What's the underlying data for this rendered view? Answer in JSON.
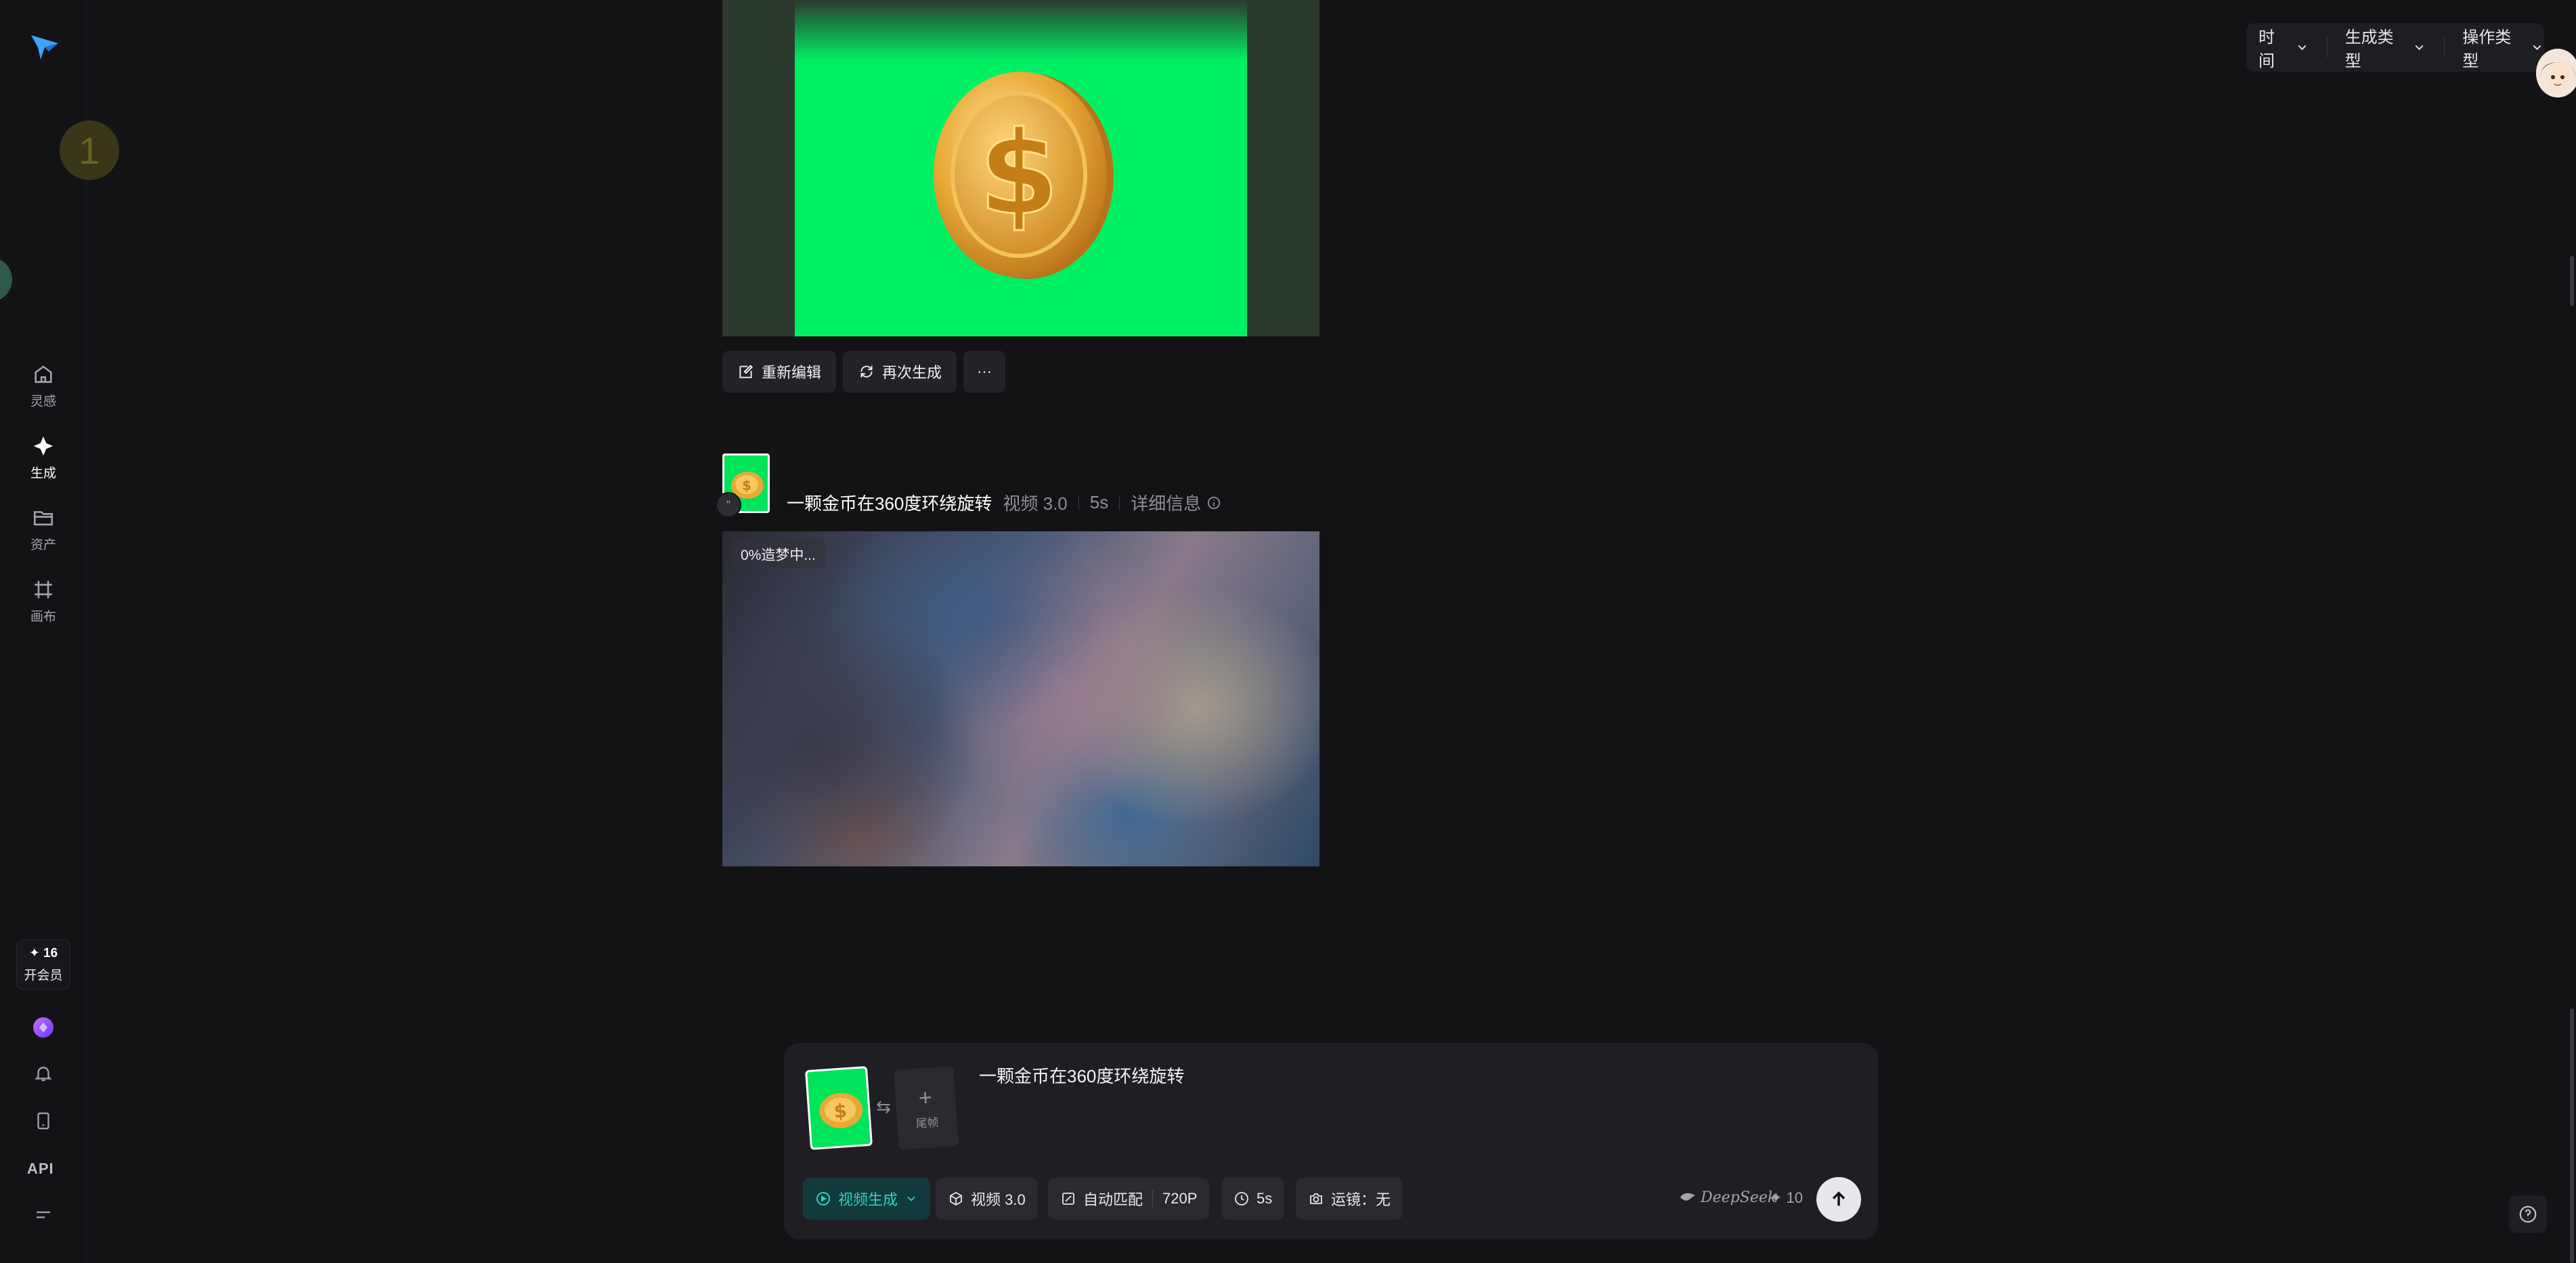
{
  "sidebar": {
    "step_number": "1",
    "nav": [
      {
        "label": "灵感",
        "icon": "home-icon"
      },
      {
        "label": "生成",
        "icon": "sparkle-icon"
      },
      {
        "label": "资产",
        "icon": "folder-icon"
      },
      {
        "label": "画布",
        "icon": "canvas-icon"
      }
    ],
    "credits": "✦ 16",
    "join_label": "开会员",
    "api_label": "API"
  },
  "filters": {
    "time": "时间",
    "gen_type": "生成类型",
    "op_type": "操作类型"
  },
  "card1": {
    "reedit_label": "重新编辑",
    "regen_label": "再次生成",
    "more_label": "···"
  },
  "card2": {
    "quote_icon": "“",
    "title": "一颗金币在360度环绕旋转",
    "model": "视频 3.0",
    "duration": "5s",
    "details": "详细信息",
    "progress": "0%造梦中..."
  },
  "composer": {
    "swap_symbol": "⇆",
    "end_frame_plus": "+",
    "end_frame_label": "尾帧",
    "prompt": "一颗金币在360度环绕旋转",
    "mode_label": "视频生成",
    "model_label": "视频 3.0",
    "ratio_label": "自动匹配",
    "resolution": "720P",
    "duration": "5s",
    "camera_label": "运镜：无",
    "deepseek_label": "DeepSeek",
    "cost": "✦ 10"
  },
  "colors": {
    "accent": "#2fd1c4",
    "background": "#131316",
    "green_screen": "#00f064"
  }
}
